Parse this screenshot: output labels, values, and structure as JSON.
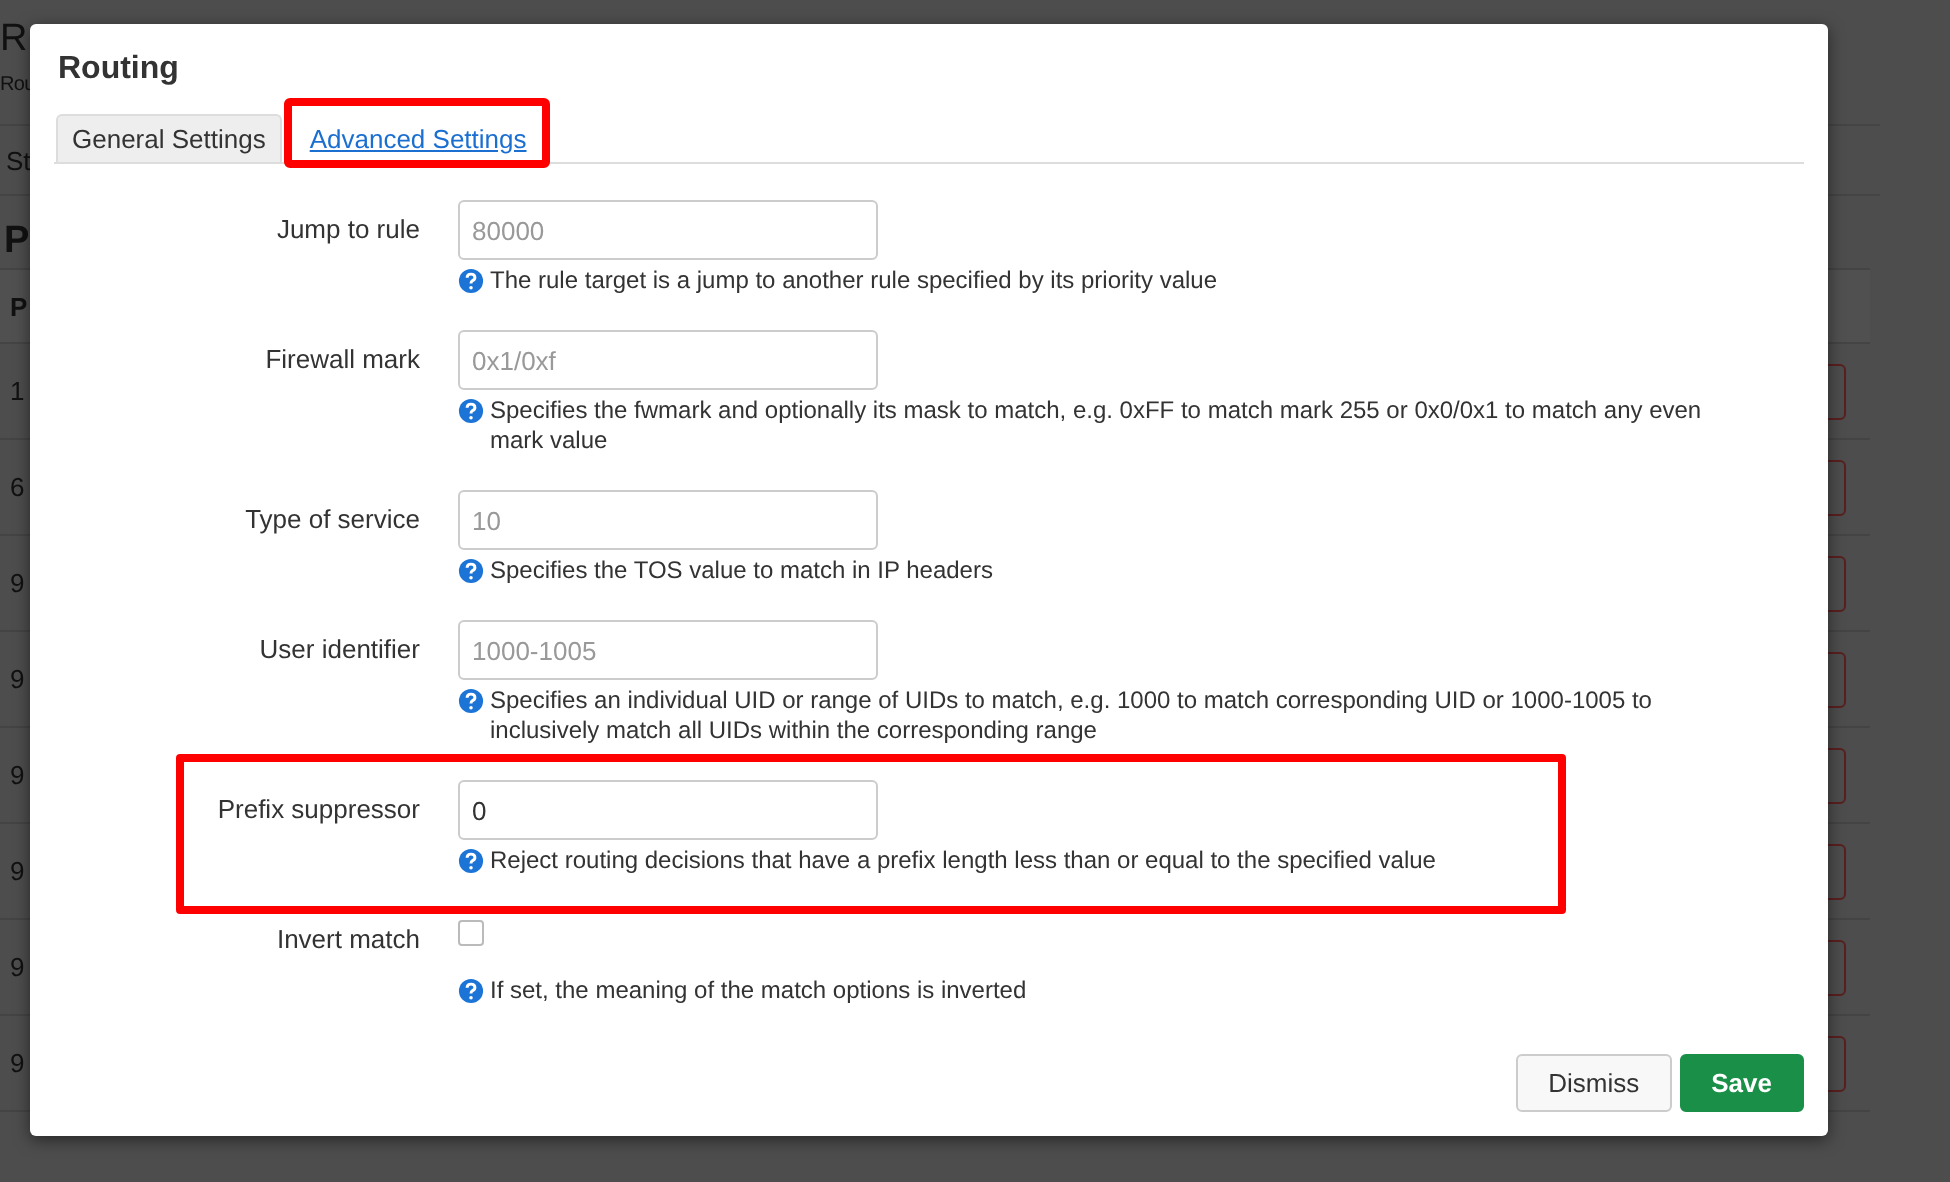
{
  "background_page": {
    "heading": "R",
    "subtitle": "Rou",
    "tab": "St",
    "section_heading": "P",
    "table": {
      "column_1": "P",
      "rows": [
        {
          "column_1": "1"
        },
        {
          "column_1": "6"
        },
        {
          "column_1": "9"
        },
        {
          "column_1": "9"
        },
        {
          "column_1": "9"
        },
        {
          "column_1": "9"
        },
        {
          "column_1": "9"
        },
        {
          "column_1": "9"
        }
      ]
    }
  },
  "dialog": {
    "title": "Routing",
    "tabs": [
      {
        "label": "General Settings",
        "selected": false,
        "highlighted": false
      },
      {
        "label": "Advanced Settings",
        "selected": true,
        "highlighted": true
      }
    ],
    "fields": [
      {
        "kind": "text",
        "label": "Jump to rule",
        "placeholder": "80000",
        "help": "The rule target is a jump to another rule specified by its priority value",
        "highlighted": false
      },
      {
        "kind": "text",
        "label": "Firewall mark",
        "placeholder": "0x1/0xf",
        "help": "Specifies the fwmark and optionally its mask to match, e.g. 0xFF to match mark 255 or 0x0/0x1 to match any even mark value",
        "highlighted": false
      },
      {
        "kind": "text",
        "label": "Type of service",
        "placeholder": "10",
        "help": "Specifies the TOS value to match in IP headers",
        "highlighted": false
      },
      {
        "kind": "text",
        "label": "User identifier",
        "placeholder": "1000-1005",
        "help": "Specifies an individual UID or range of UIDs to match, e.g. 1000 to match corresponding UID or 1000-1005 to inclusively match all UIDs within the corresponding range",
        "highlighted": false
      },
      {
        "kind": "text",
        "label": "Prefix suppressor",
        "value": "0",
        "help": "Reject routing decisions that have a prefix length less than or equal to the specified value",
        "highlighted": true
      },
      {
        "kind": "checkbox",
        "label": "Invert match",
        "checked": false,
        "help": "If set, the meaning of the match options is inverted",
        "highlighted": false
      }
    ],
    "buttons": [
      {
        "kind": "neutral",
        "label": "Dismiss"
      },
      {
        "kind": "primary",
        "label": "Save"
      }
    ]
  }
}
